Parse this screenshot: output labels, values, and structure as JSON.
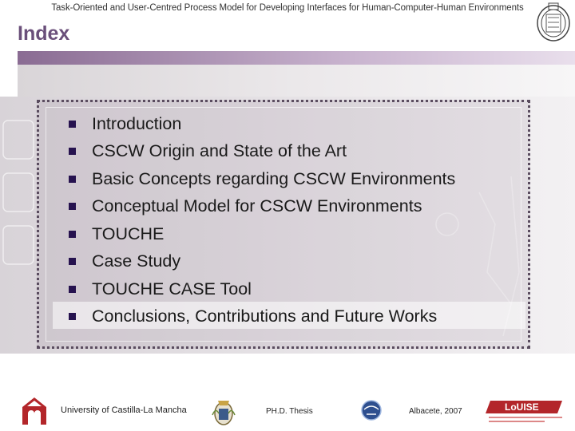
{
  "header": {
    "running_title": "Task-Oriented and User-Centred Process Model for Developing Interfaces for Human-Computer-Human Environments"
  },
  "slide": {
    "title": "Index",
    "items": [
      {
        "label": "Introduction"
      },
      {
        "label": "CSCW Origin and State of the Art"
      },
      {
        "label": "Basic Concepts regarding CSCW Environments"
      },
      {
        "label": "Conceptual Model for CSCW Environments"
      },
      {
        "label": "TOUCHE"
      },
      {
        "label": "Case Study"
      },
      {
        "label": "TOUCHE CASE Tool"
      },
      {
        "label": "Conclusions, Contributions and Future Works"
      }
    ],
    "highlighted_item_index": 7
  },
  "footer": {
    "university": "University of Castilla-La Mancha",
    "thesis": "PH.D. Thesis",
    "place_date": "Albacete, 2007",
    "lab_logo_text": "LoUISE"
  },
  "colors": {
    "title": "#6a4f7a",
    "bullet": "#26124f",
    "bar_purple": "#8a6c93",
    "logo_red": "#b3262a"
  },
  "icons": [
    "university-seal-icon",
    "ucm-logo-icon",
    "crest-logo-icon",
    "osi-logo-icon",
    "louise-logo-icon"
  ]
}
